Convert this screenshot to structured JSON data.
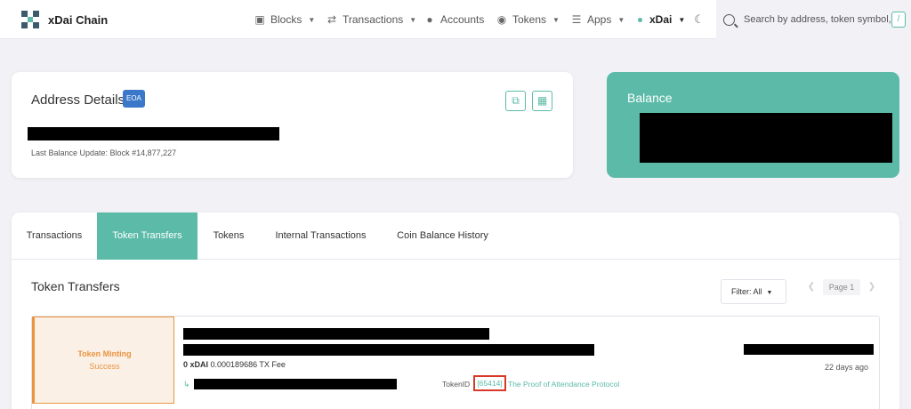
{
  "app": {
    "name": "xDai Chain"
  },
  "nav": {
    "blocks": "Blocks",
    "transactions": "Transactions",
    "accounts": "Accounts",
    "tokens": "Tokens",
    "apps": "Apps",
    "network": "xDai"
  },
  "search": {
    "placeholder": "Search by address, token symbol, n",
    "shortcut": "/"
  },
  "address_card": {
    "title": "Address Details",
    "badge": "EOA",
    "last_balance_update": "Last Balance Update: Block #14,877,227"
  },
  "balance_card": {
    "title": "Balance"
  },
  "tabs": [
    {
      "label": "Transactions"
    },
    {
      "label": "Token Transfers"
    },
    {
      "label": "Tokens"
    },
    {
      "label": "Internal Transactions"
    },
    {
      "label": "Coin Balance History"
    }
  ],
  "active_tab": "Token Transfers",
  "section": {
    "title": "Token Transfers",
    "filter_label": "Filter: All",
    "page_label": "Page 1"
  },
  "transfer": {
    "type": "Token Minting",
    "status": "Success",
    "fee_amount": "0 xDAI",
    "fee_text": "0.000189686 TX Fee",
    "time": "22 days ago",
    "token_id_label": "TokenID",
    "token_id": "[65414]",
    "token_name": "The Proof of Attendance Protocol"
  },
  "colors": {
    "accent": "#5bbba8",
    "warning": "#e99440",
    "highlight": "#d83a2a",
    "badge": "#3b78c9"
  },
  "icons": [
    "cube-icon",
    "transfer-icon",
    "user-icon",
    "coins-icon",
    "layers-icon",
    "moon-icon",
    "search-icon",
    "copy-icon",
    "qr-code-icon"
  ]
}
